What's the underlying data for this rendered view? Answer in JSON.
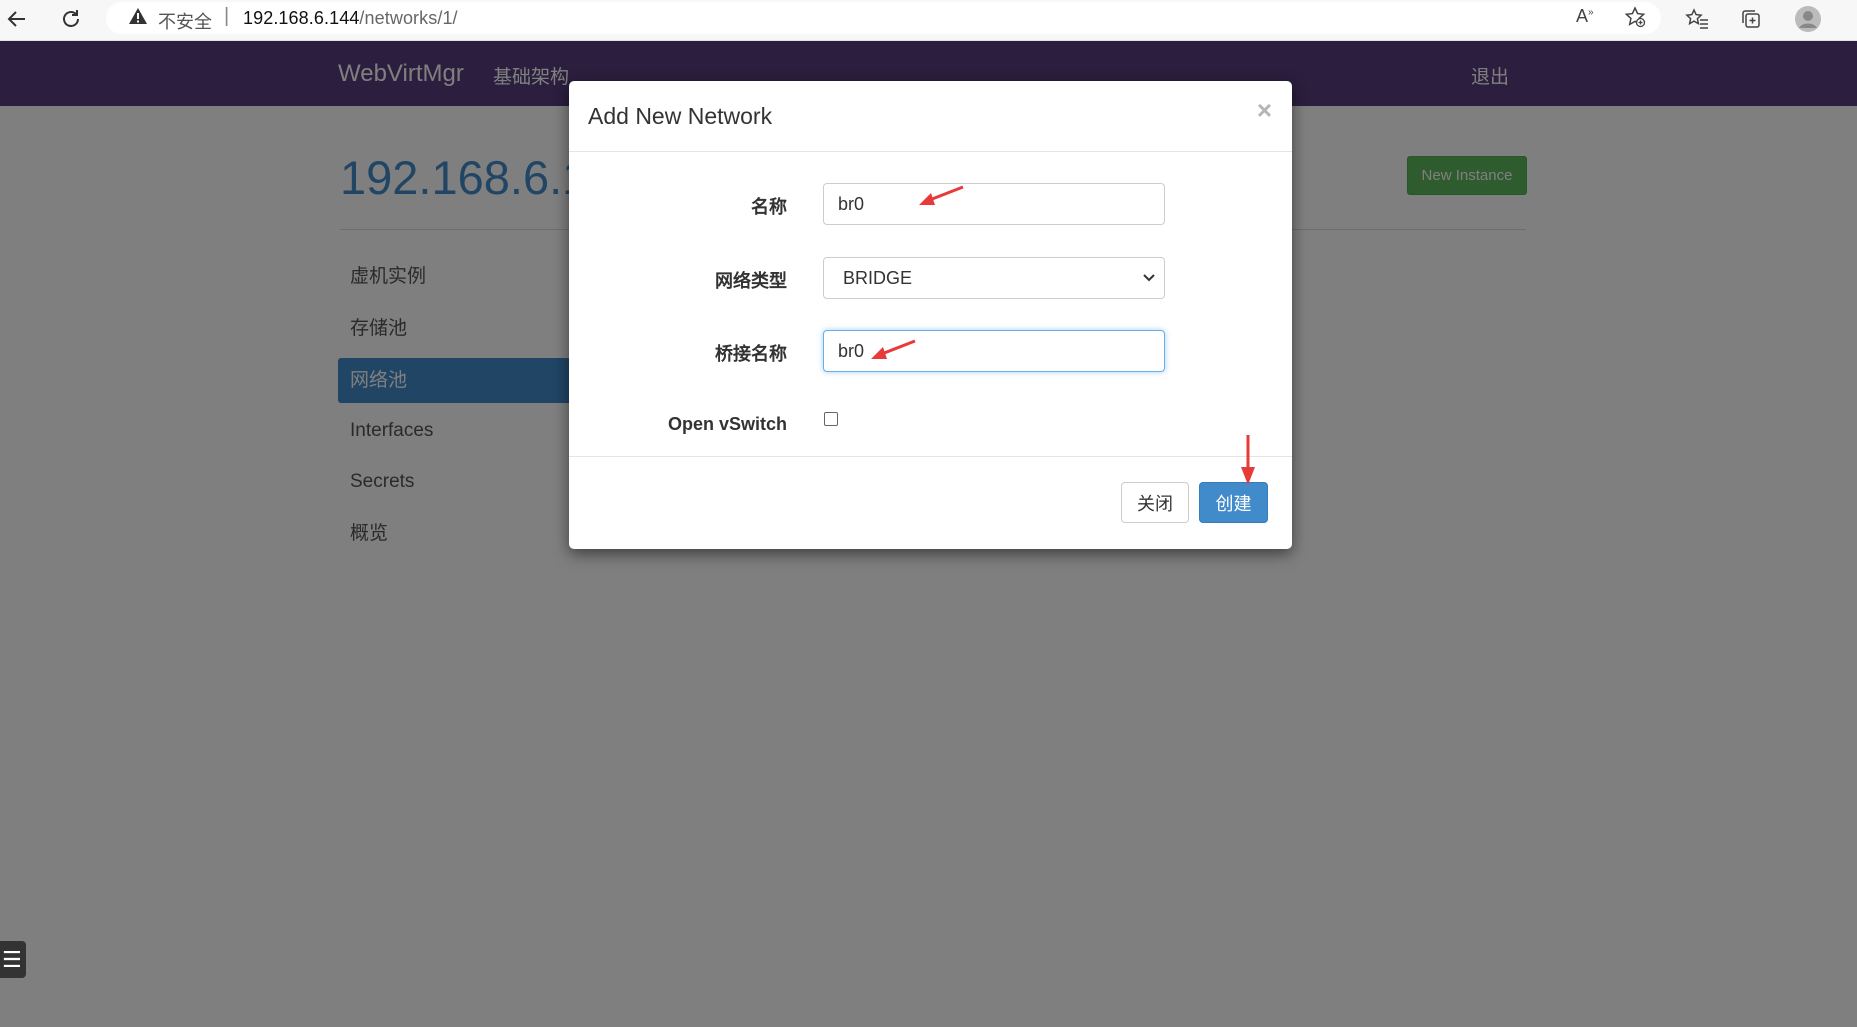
{
  "browser": {
    "security_warning": "不安全",
    "separator": "|",
    "url_host": "192.168.6.144",
    "url_path": "/networks/1/"
  },
  "navbar": {
    "brand": "WebVirtMgr",
    "infrastructure_link": "基础架构",
    "logout_link": "退出"
  },
  "page": {
    "title": "192.168.6.1",
    "new_instance_button": "New Instance"
  },
  "sidebar": {
    "items": [
      {
        "label": "虚机实例"
      },
      {
        "label": "存储池"
      },
      {
        "label": "网络池"
      },
      {
        "label": "Interfaces"
      },
      {
        "label": "Secrets"
      },
      {
        "label": "概览"
      }
    ]
  },
  "modal": {
    "title": "Add New Network",
    "close_symbol": "×",
    "fields": {
      "name_label": "名称",
      "name_value": "br0",
      "type_label": "网络类型",
      "type_value": "BRIDGE",
      "bridge_label": "桥接名称",
      "bridge_value": "br0",
      "ovs_label": "Open vSwitch",
      "ovs_checked": false
    },
    "close_button": "关闭",
    "create_button": "创建"
  },
  "colors": {
    "navbar": "#563d7c",
    "primary": "#428bca",
    "success": "#5cb85c",
    "annotation": "#e83a3a"
  }
}
